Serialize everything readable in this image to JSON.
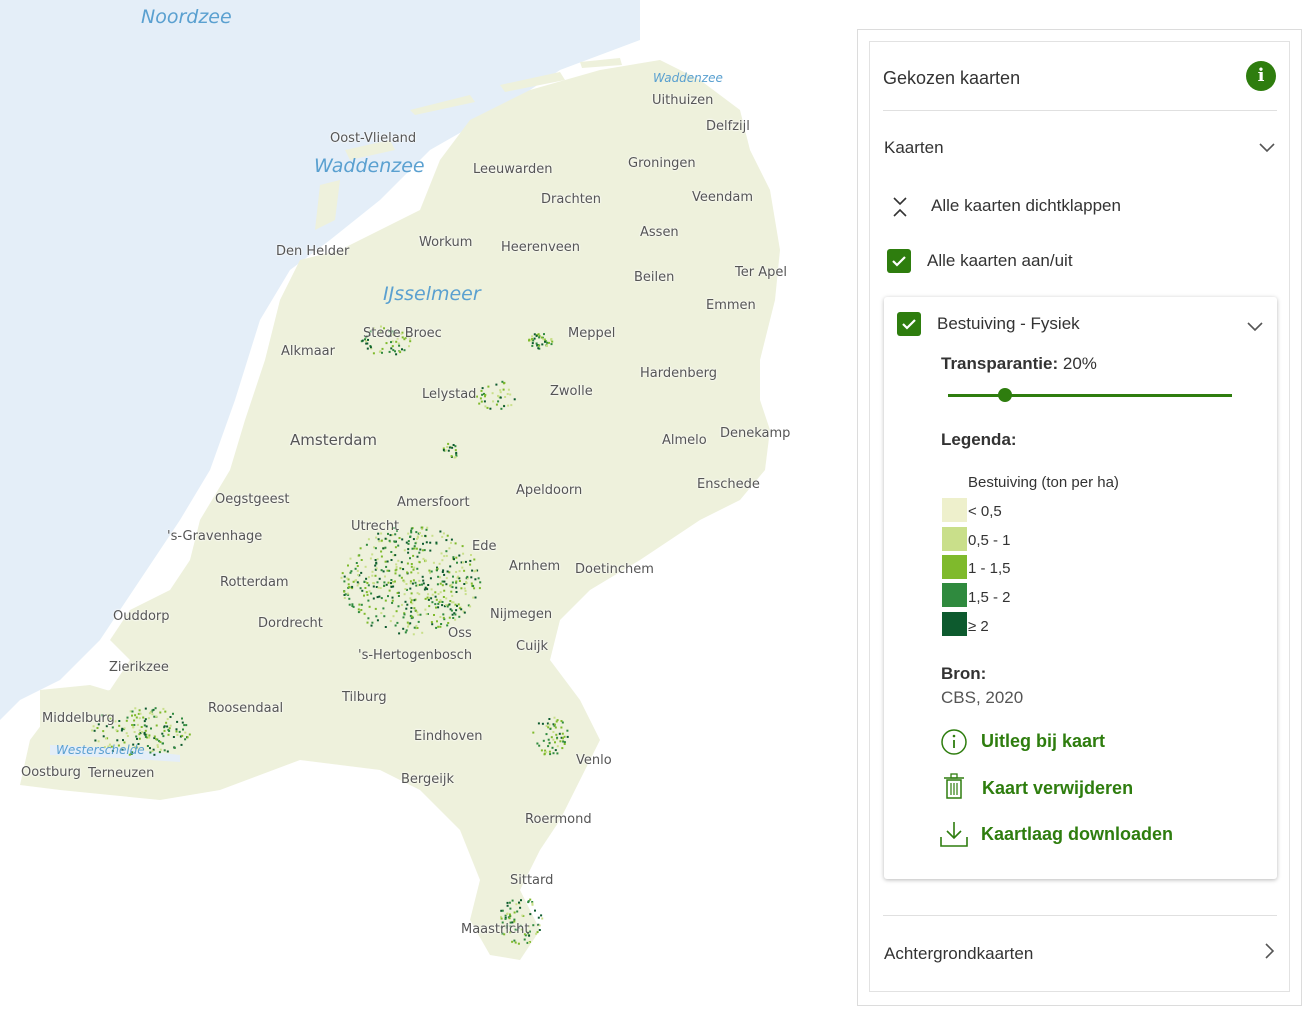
{
  "map": {
    "water_labels": [
      {
        "name": "Noordzee",
        "size": "big"
      },
      {
        "name": "Waddenzee",
        "size": "big"
      },
      {
        "name": "IJsselmeer",
        "size": "big"
      },
      {
        "name": "Waddenzee",
        "size": "small"
      },
      {
        "name": "Westerschelde",
        "size": "small"
      }
    ],
    "places": [
      "Uithuizen",
      "Delfzijl",
      "Oost-Vlieland",
      "Leeuwarden",
      "Groningen",
      "Drachten",
      "Veendam",
      "Den Helder",
      "Workum",
      "Heerenveen",
      "Assen",
      "Beilen",
      "Ter Apel",
      "Emmen",
      "Stede Broec",
      "Meppel",
      "Alkmaar",
      "Hardenberg",
      "Lelystad",
      "Zwolle",
      "Amsterdam",
      "Almelo",
      "Denekamp",
      "Enschede",
      "Oegstgeest",
      "Amersfoort",
      "Apeldoorn",
      "Utrecht",
      "'s-Gravenhage",
      "Ede",
      "Arnhem",
      "Doetinchem",
      "Rotterdam",
      "Nijmegen",
      "Ouddorp",
      "Dordrecht",
      "Oss",
      "Cuijk",
      "'s-Hertogenbosch",
      "Zierikzee",
      "Tilburg",
      "Roosendaal",
      "Middelburg",
      "Eindhoven",
      "Venlo",
      "Oostburg",
      "Terneuzen",
      "Bergeijk",
      "Roermond",
      "Sittard",
      "Maastricht"
    ],
    "colors": {
      "land": "#eef1dc",
      "sea": "#e4eef8",
      "class1": "#eef0cc",
      "class2": "#c9df8a",
      "class3": "#7fba2c",
      "class4": "#2f8a3e",
      "class5": "#0d5a2e"
    }
  },
  "panel": {
    "title": "Gekozen kaarten",
    "info_icon": "info-icon",
    "kaarten_label": "Kaarten",
    "collapse_all_label": "Alle kaarten dichtklappen",
    "toggle_all_label": "Alle kaarten aan/uit",
    "toggle_all_checked": true,
    "layer": {
      "name": "Bestuiving - Fysiek",
      "checked": true,
      "transparency_label": "Transparantie:",
      "transparency_value": "20%",
      "transparency_fraction": 0.2,
      "legend_label": "Legenda:",
      "legend_title": "Bestuiving (ton per ha)",
      "legend_items": [
        {
          "label": "< 0,5",
          "color": "#eef0cc"
        },
        {
          "label": "0,5 - 1",
          "color": "#c9df8a"
        },
        {
          "label": "1 - 1,5",
          "color": "#7fba2c"
        },
        {
          "label": "1,5 - 2",
          "color": "#2f8a3e"
        },
        {
          "label": "≥ 2",
          "color": "#0d5a2e"
        }
      ],
      "source_label": "Bron:",
      "source_value": "CBS, 2020",
      "actions": {
        "explain": "Uitleg bij kaart",
        "remove": "Kaart verwijderen",
        "download": "Kaartlaag downloaden"
      }
    },
    "background_label": "Achtergrondkaarten",
    "accent_color": "#2e7d0e"
  }
}
